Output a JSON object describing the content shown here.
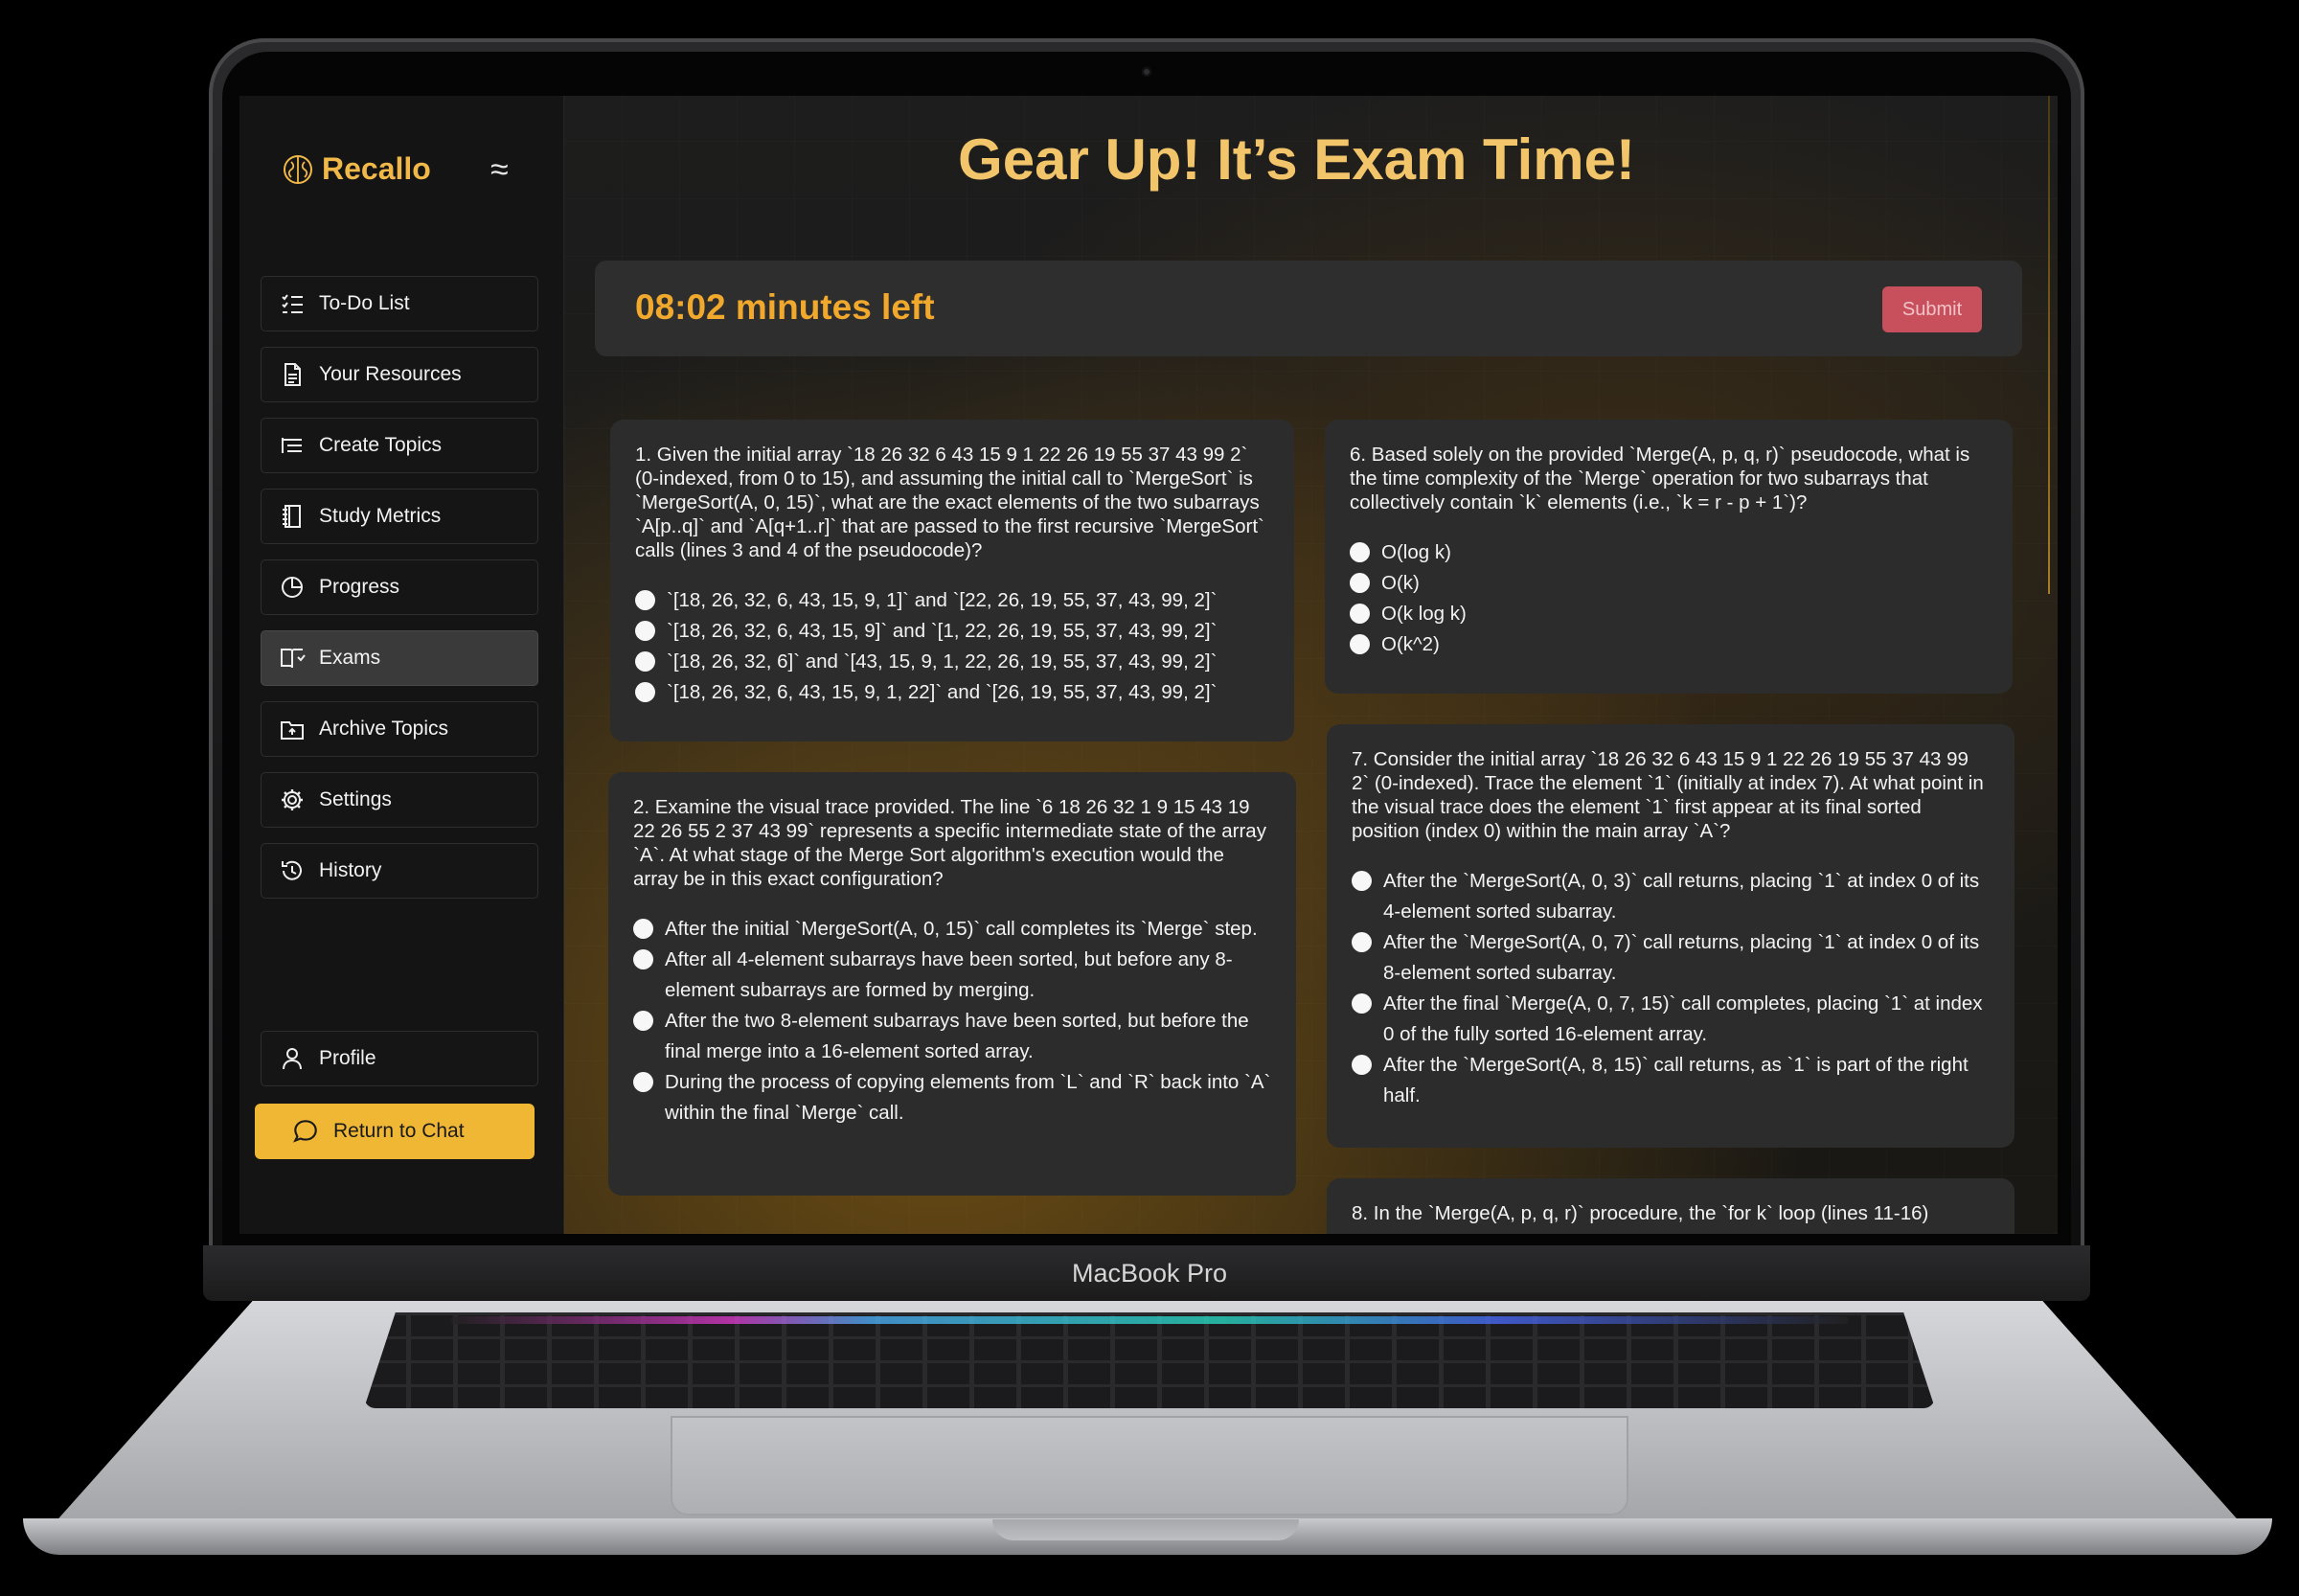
{
  "device": {
    "label": "MacBook Pro"
  },
  "app": {
    "name": "Recallo",
    "accent": "#f0b735"
  },
  "sidebar": {
    "menu_icon": "≈",
    "items": [
      {
        "label": "To-Do List",
        "icon": "checklist-icon"
      },
      {
        "label": "Your Resources",
        "icon": "document-icon"
      },
      {
        "label": "Create Topics",
        "icon": "list-icon"
      },
      {
        "label": "Study Metrics",
        "icon": "notebook-icon"
      },
      {
        "label": "Progress",
        "icon": "pie-chart-icon"
      },
      {
        "label": "Exams",
        "icon": "book-icon"
      },
      {
        "label": "Archive Topics",
        "icon": "folder-icon"
      },
      {
        "label": "Settings",
        "icon": "gear-icon"
      },
      {
        "label": "History",
        "icon": "history-icon"
      }
    ],
    "profile_label": "Profile",
    "return_label": "Return to Chat"
  },
  "page": {
    "title": "Gear Up! It’s Exam Time!",
    "timer": "08:02 minutes left",
    "submit_label": "Submit"
  },
  "questions": [
    {
      "text": "1. Given the initial array `18 26 32 6 43 15 9 1 22 26 19 55 37 43 99 2` (0-indexed, from 0 to 15), and assuming the initial call to `MergeSort` is `MergeSort(A, 0, 15)`, what are the exact elements of the two subarrays `A[p..q]` and `A[q+1..r]` that are passed to the first recursive `MergeSort` calls (lines 3 and 4 of the pseudocode)?",
      "options": [
        "`[18, 26, 32, 6, 43, 15, 9, 1]` and `[22, 26, 19, 55, 37, 43, 99, 2]`",
        "`[18, 26, 32, 6, 43, 15, 9]` and `[1, 22, 26, 19, 55, 37, 43, 99, 2]`",
        "`[18, 26, 32, 6]` and `[43, 15, 9, 1, 22, 26, 19, 55, 37, 43, 99, 2]`",
        "`[18, 26, 32, 6, 43, 15, 9, 1, 22]` and `[26, 19, 55, 37, 43, 99, 2]`"
      ]
    },
    {
      "text": "2. Examine the visual trace provided. The line `6 18 26 32 1 9 15 43 19 22 26 55 2 37 43 99` represents a specific intermediate state of the array `A`. At what stage of the Merge Sort algorithm's execution would the array be in this exact configuration?",
      "options": [
        "After the initial `MergeSort(A, 0, 15)` call completes its `Merge` step.",
        "After all 4-element subarrays have been sorted, but before any 8-element subarrays are formed by merging.",
        "After the two 8-element subarrays have been sorted, but before the final merge into a 16-element sorted array.",
        "During the process of copying elements from `L` and `R` back into `A` within the final `Merge` call."
      ]
    },
    {
      "text": "6. Based solely on the provided `Merge(A, p, q, r)` pseudocode, what is the time complexity of the `Merge` operation for two subarrays that collectively contain `k` elements (i.e., `k = r - p + 1`)?",
      "options": [
        "O(log k)",
        "O(k)",
        "O(k log k)",
        "O(k^2)"
      ]
    },
    {
      "text": "7. Consider the initial array `18 26 32 6 43 15 9 1 22 26 19 55 37 43 99 2` (0-indexed). Trace the element `1` (initially at index 7). At what point in the visual trace does the element `1` first appear at its final sorted position (index 0) within the main array `A`?",
      "options": [
        "After the `MergeSort(A, 0, 3)` call returns, placing `1` at index 0 of its 4-element sorted subarray.",
        "After the `MergeSort(A, 0, 7)` call returns, placing `1` at index 0 of its 8-element sorted subarray.",
        "After the final `Merge(A, 0, 7, 15)` call completes, placing `1` at index 0 of the fully sorted 16-element array.",
        "After the `MergeSort(A, 8, 15)` call returns, as `1` is part of the right half."
      ]
    },
    {
      "text": "8. In the `Merge(A, p, q, r)` procedure, the `for k` loop (lines 11-16)",
      "options": []
    }
  ]
}
